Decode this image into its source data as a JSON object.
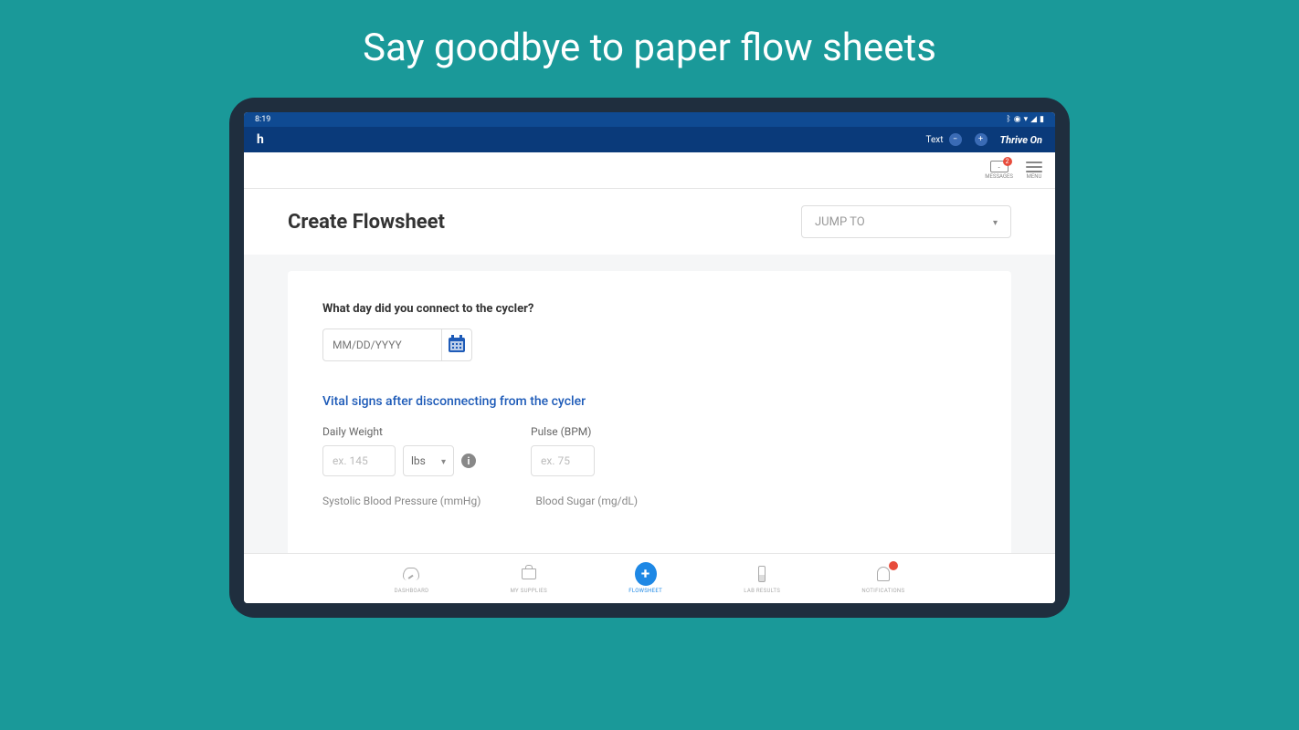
{
  "headline": "Say goodbye to paper flow sheets",
  "statusbar": {
    "time": "8:19"
  },
  "appheader": {
    "logo": "h",
    "text_label": "Text",
    "brand": "Thrive On"
  },
  "toolbar": {
    "messages": {
      "label": "MESSAGES",
      "badge": "2"
    },
    "menu": {
      "label": "MENU"
    }
  },
  "page": {
    "title": "Create Flowsheet",
    "jumpto": "JUMP TO"
  },
  "form": {
    "q1": "What day did you connect to the cycler?",
    "date_placeholder": "MM/DD/YYYY",
    "section_title": "Vital signs after disconnecting from the cycler",
    "weight": {
      "label": "Daily Weight",
      "placeholder": "ex. 145",
      "unit": "lbs"
    },
    "pulse": {
      "label": "Pulse (BPM)",
      "placeholder": "ex. 75"
    },
    "trunc1": "Systolic Blood Pressure (mmHg)",
    "trunc2": "Blood Sugar (mg/dL)"
  },
  "nav": {
    "dashboard": "DASHBOARD",
    "supplies": "MY SUPPLIES",
    "flowsheet": "FLOWSHEET",
    "lab": "LAB RESULTS",
    "notifications": "NOTIFICATIONS"
  }
}
